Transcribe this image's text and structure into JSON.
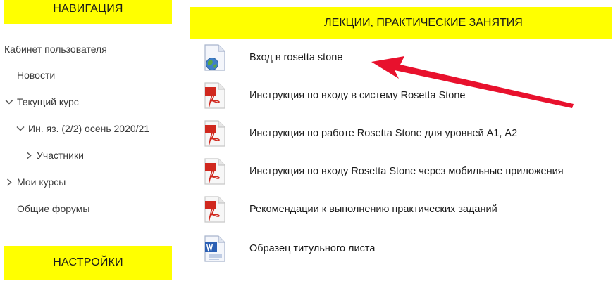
{
  "sidebar": {
    "navigation_header": "НАВИГАЦИЯ",
    "settings_header": "НАСТРОЙКИ",
    "items": [
      {
        "label": "Кабинет пользователя"
      },
      {
        "label": "Новости"
      },
      {
        "label": "Текущий курс"
      },
      {
        "label": "Ин. яз. (2/2) осень 2020/21"
      },
      {
        "label": "Участники"
      },
      {
        "label": "Мои курсы"
      },
      {
        "label": "Общие форумы"
      }
    ]
  },
  "main": {
    "section_header": "ЛЕКЦИИ, ПРАКТИЧЕСКИЕ ЗАНЯТИЯ",
    "activities": [
      {
        "label": "Вход в rosetta stone",
        "icon": "url-globe-icon"
      },
      {
        "label": "Инструкция по входу в систему Rosetta Stone",
        "icon": "pdf-icon"
      },
      {
        "label": "Инструкция по работе Rosetta Stone для уровней А1, А2",
        "icon": "pdf-icon"
      },
      {
        "label": "Инструкция по входу Rosetta Stone через мобильные приложения",
        "icon": "pdf-icon"
      },
      {
        "label": "Рекомендации к выполнению практических заданий",
        "icon": "pdf-icon"
      },
      {
        "label": "Образец титульного листа",
        "icon": "word-doc-icon"
      }
    ]
  },
  "colors": {
    "header_yellow": "#ffff00",
    "arrow_red": "#e8112d",
    "pdf_red": "#d0281e",
    "word_blue": "#2b5fb4"
  }
}
